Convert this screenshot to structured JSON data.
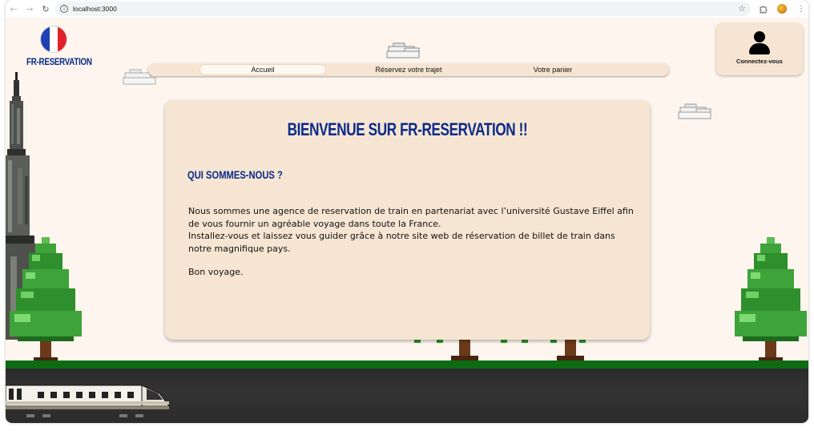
{
  "browser": {
    "url": "localhost:3000"
  },
  "site": {
    "brand": "FR-RESERVATION",
    "flag_colors": [
      "#1f3fb4",
      "#ffffff",
      "#e02128"
    ]
  },
  "nav": {
    "items": [
      {
        "label": "Accueil",
        "active": true
      },
      {
        "label": "Réservez votre trajet",
        "active": false
      },
      {
        "label": "Votre panier",
        "active": false
      }
    ]
  },
  "account": {
    "login_label": "Connectez-vous"
  },
  "main": {
    "title": "BIENVENUE SUR FR-RESERVATION !!",
    "subtitle": "QUI SOMMES-NOUS ?",
    "paragraph1": "Nous sommes une agence de reservation de train en partenariat avec l’université Gustave Eiffel afin de vous fournir un agréable voyage dans toute la France.",
    "paragraph2": "Installez-vous et laissez vous guider grâce à notre site web de réservation de billet de train dans notre magnifique pays.",
    "paragraph3": "Bon voyage."
  },
  "colors": {
    "page_background": "#fdf5ee",
    "card_background": "#f6e5d2",
    "brand_blue": "#0a2a8a",
    "ground_green": "#0d6b12"
  }
}
